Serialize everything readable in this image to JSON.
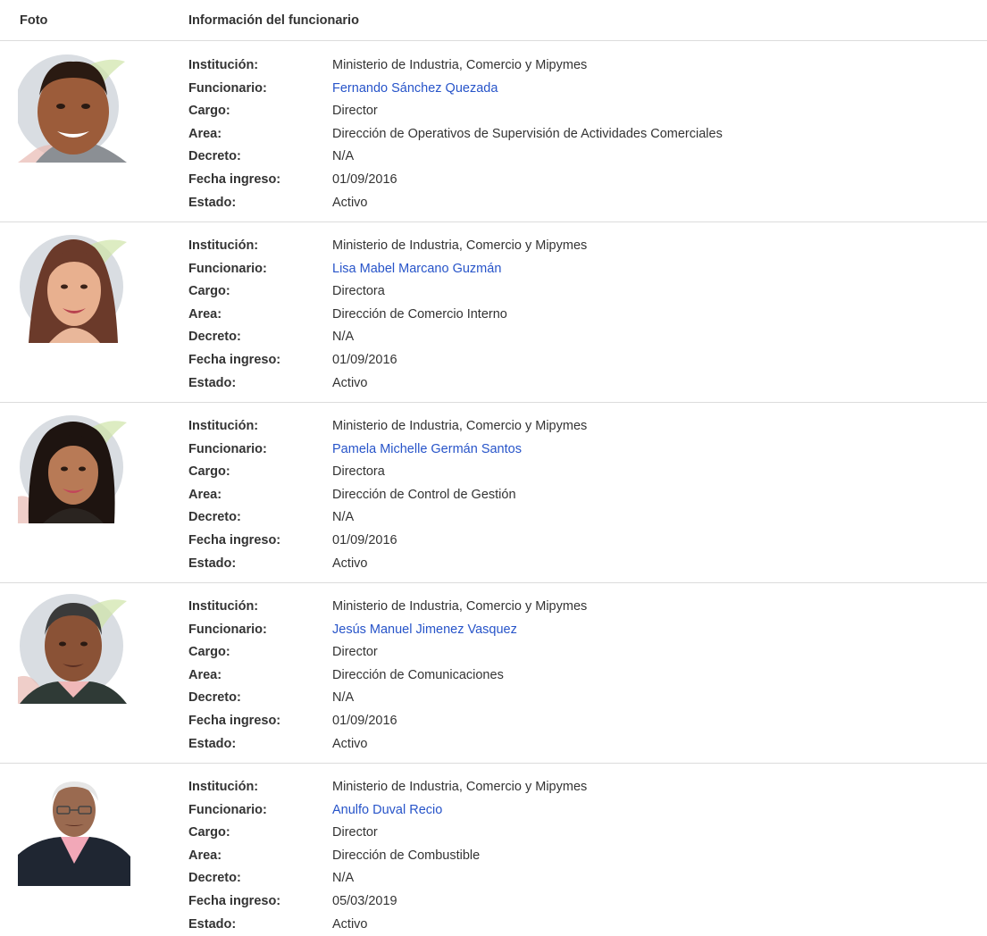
{
  "header": {
    "foto": "Foto",
    "info": "Información del funcionario"
  },
  "labels": {
    "institucion": "Institución:",
    "funcionario": "Funcionario:",
    "cargo": "Cargo:",
    "area": "Area:",
    "decreto": "Decreto:",
    "fecha": "Fecha ingreso:",
    "estado": "Estado:"
  },
  "rows": [
    {
      "institucion": "Ministerio de Industria, Comercio y Mipymes",
      "funcionario": "Fernando Sánchez Quezada",
      "cargo": "Director",
      "area": "Dirección de Operativos de Supervisión de Actividades Comerciales",
      "decreto": "N/A",
      "fecha": "01/09/2016",
      "estado": "Activo"
    },
    {
      "institucion": "Ministerio de Industria, Comercio y Mipymes",
      "funcionario": "Lisa Mabel Marcano Guzmán",
      "cargo": "Directora",
      "area": "Dirección de Comercio Interno",
      "decreto": "N/A",
      "fecha": "01/09/2016",
      "estado": "Activo"
    },
    {
      "institucion": "Ministerio de Industria, Comercio y Mipymes",
      "funcionario": "Pamela Michelle Germán Santos",
      "cargo": "Directora",
      "area": "Dirección de Control de Gestión",
      "decreto": "N/A",
      "fecha": "01/09/2016",
      "estado": "Activo"
    },
    {
      "institucion": "Ministerio de Industria, Comercio y Mipymes",
      "funcionario": "Jesús Manuel Jimenez Vasquez",
      "cargo": "Director",
      "area": "Dirección de Comunicaciones",
      "decreto": "N/A",
      "fecha": "01/09/2016",
      "estado": "Activo"
    },
    {
      "institucion": "Ministerio de Industria, Comercio y Mipymes",
      "funcionario": "Anulfo Duval Recio",
      "cargo": "Director",
      "area": "Dirección de Combustible",
      "decreto": "N/A",
      "fecha": "05/03/2019",
      "estado": "Activo"
    }
  ]
}
